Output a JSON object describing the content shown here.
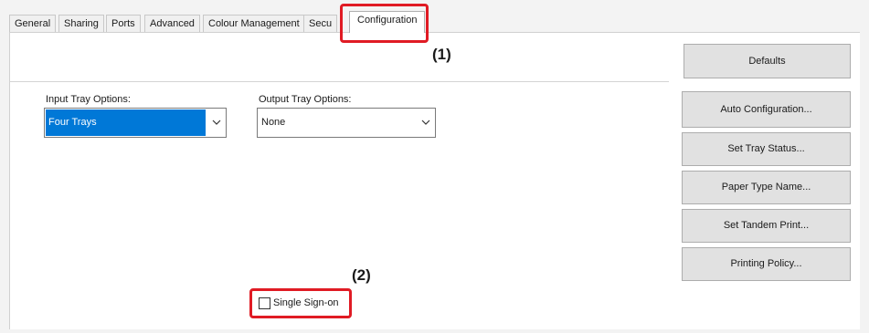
{
  "tabs": [
    {
      "label": "General"
    },
    {
      "label": "Sharing"
    },
    {
      "label": "Ports"
    },
    {
      "label": "Advanced"
    },
    {
      "label": "Colour Management"
    },
    {
      "label": "Secu"
    },
    {
      "label": "Configuration",
      "active": true
    }
  ],
  "callouts": {
    "one": "(1)",
    "two": "(2)"
  },
  "input_tray": {
    "label": "Input Tray Options:",
    "value": "Four Trays"
  },
  "output_tray": {
    "label": "Output Tray Options:",
    "value": "None"
  },
  "buttons": {
    "defaults": "Defaults",
    "auto_configuration": "Auto Configuration...",
    "set_tray_status": "Set Tray Status...",
    "paper_type_name": "Paper Type Name...",
    "set_tandem_print": "Set Tandem Print...",
    "printing_policy": "Printing Policy..."
  },
  "single_sign_on": {
    "label": "Single Sign-on",
    "checked": false
  },
  "colors": {
    "selection": "#0078d7",
    "callout_border": "#e01b24"
  }
}
